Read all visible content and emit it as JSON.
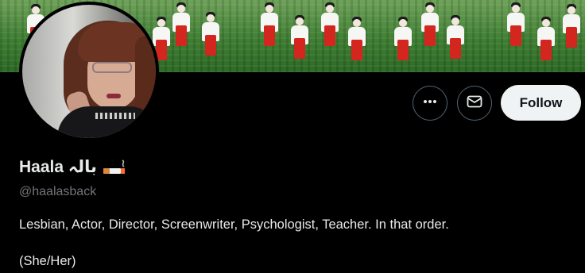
{
  "profile": {
    "display_name": "Haala بالہ",
    "handle": "@haalasback",
    "bio_line": "Lesbian, Actor, Director, Screenwriter, Psychologist, Teacher. In that order.",
    "pronouns": "(She/Her)"
  },
  "actions": {
    "follow_label": "Follow",
    "more_icon": "ellipsis-icon",
    "message_icon": "envelope-icon"
  },
  "colors": {
    "background": "#000000",
    "primary_text": "#e7e9ea",
    "secondary_text": "#71767b",
    "follow_button_bg": "#eff3f4",
    "icon_button_border": "#536471"
  }
}
